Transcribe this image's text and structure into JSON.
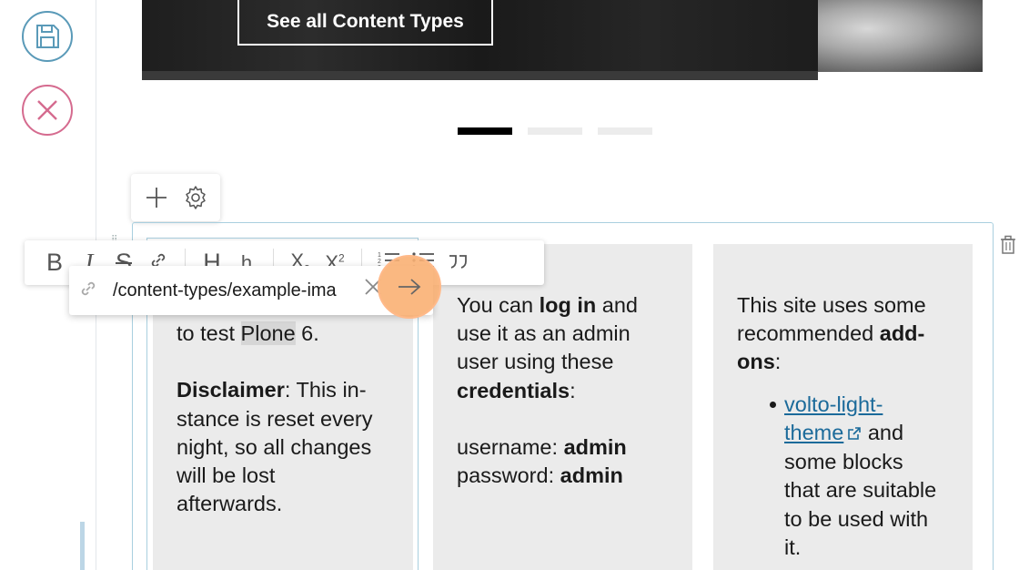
{
  "hero": {
    "cta_label": "See all Content Types"
  },
  "slider": {
    "dot_count": 3,
    "active_index": 0
  },
  "link_editor": {
    "url_value": "/content-types/example-ima"
  },
  "columns": {
    "col1": {
      "line_partial_prefix": "to test ",
      "highlighted_word": "Plone",
      "line_partial_suffix": " 6.",
      "disclaimer_label": "Disclaimer",
      "disclaimer_text_1": ": This in-",
      "disclaimer_lines": [
        "stance is reset every",
        "night, so all changes",
        "will be lost",
        "afterwards."
      ]
    },
    "col2": {
      "l1_pre": "You can ",
      "l1_bold": "log in",
      "l1_post": " and",
      "l2": "use it as an admin",
      "l3": "user using these",
      "l4_bold": "credentials",
      "l4_post": ":",
      "user_label": "username: ",
      "user_value": "admin",
      "pass_label": "password: ",
      "pass_value": "admin"
    },
    "col3": {
      "l1": "This site uses some",
      "l2_pre": "recommended ",
      "l2_bold": "add-",
      "l3_bold": "ons",
      "l3_post": ":",
      "link_line1": "volto-light-",
      "link_line2": "theme",
      "after_link": " and",
      "item_lines": [
        "some blocks",
        "that are suitable",
        "to be used with",
        "it."
      ]
    }
  },
  "colors": {
    "accent": "#5a9ab8",
    "cancel": "#d56b8f",
    "link": "#1b6a9a",
    "submit_highlight": "#fab073"
  }
}
